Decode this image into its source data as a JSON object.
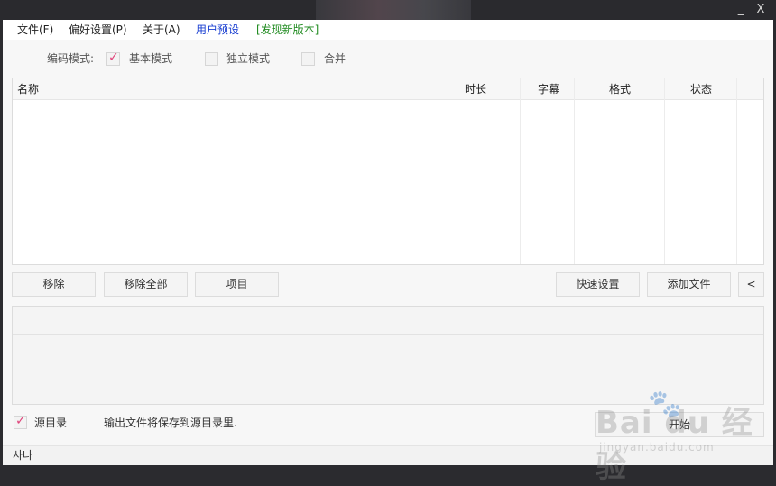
{
  "window": {
    "minimize": "_",
    "close": "X"
  },
  "menu": {
    "file": "文件(F)",
    "prefs": "偏好设置(P)",
    "about": "关于(A)",
    "presets": "用户预设",
    "new_version": "[发现新版本]"
  },
  "encode": {
    "label": "编码模式:",
    "options": [
      {
        "label": "基本模式",
        "checked": true
      },
      {
        "label": "独立模式",
        "checked": false
      },
      {
        "label": "合并",
        "checked": false
      }
    ]
  },
  "table": {
    "columns": [
      "名称",
      "时长",
      "字幕",
      "格式",
      "状态"
    ]
  },
  "buttons": {
    "remove": "移除",
    "remove_all": "移除全部",
    "project": "项目",
    "quick_settings": "快速设置",
    "add_file": "添加文件",
    "collapse": "<"
  },
  "output": {
    "source_dir_label": "源目录",
    "source_dir_checked": true,
    "message": "输出文件将保存到源目录里.",
    "start_button": "开始"
  },
  "status": {
    "text": "사나"
  },
  "watermark": {
    "brand": "Bai du 经验",
    "url": "jingyan.baidu.com"
  },
  "colors": {
    "accent_check": "#e0457b",
    "preset_link": "#1a3fd1",
    "new_version": "#1e8a1e"
  }
}
